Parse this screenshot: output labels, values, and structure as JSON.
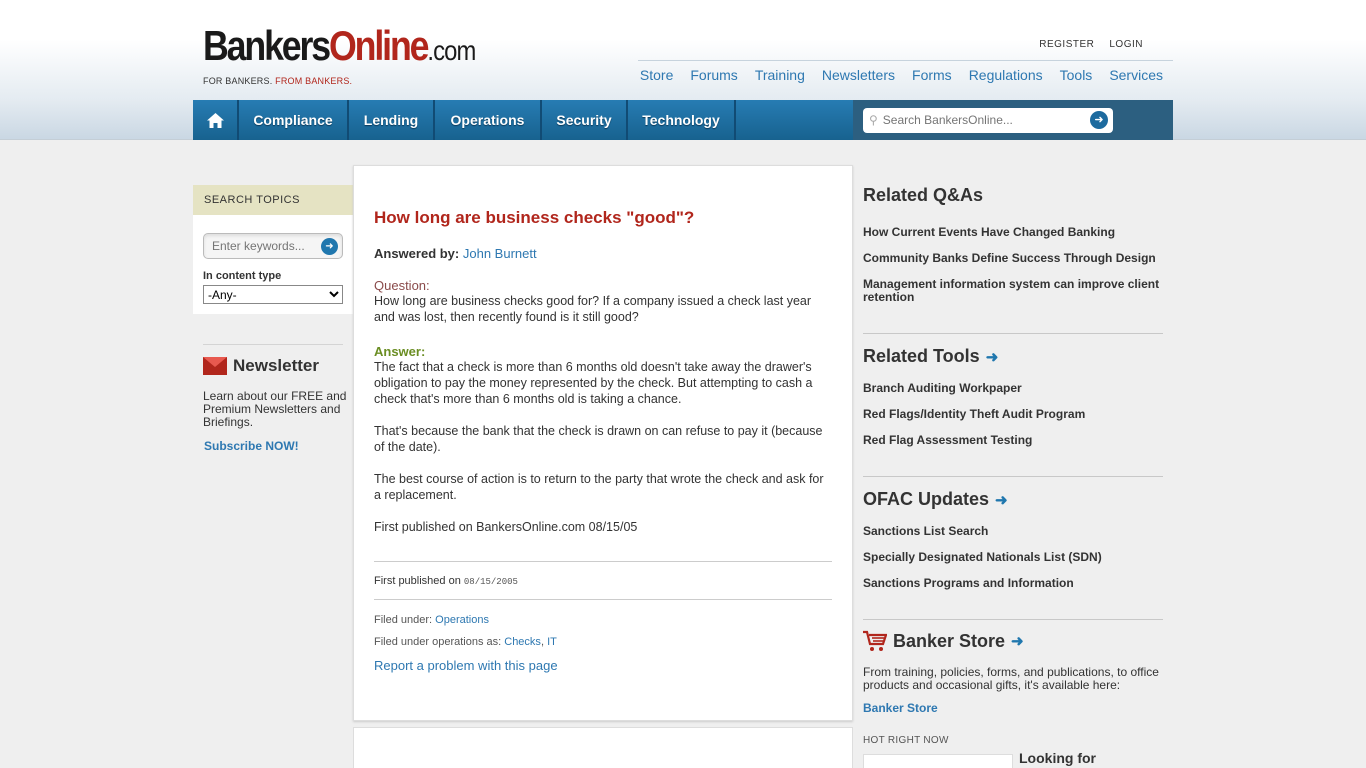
{
  "logo": {
    "part1": "Bankers",
    "part2": "Online",
    "part3": ".com",
    "tagline_a": "FOR BANKERS.",
    "tagline_b": "FROM BANKERS."
  },
  "auth": {
    "register": "REGISTER",
    "login": "LOGIN"
  },
  "util_nav": [
    "Store",
    "Forums",
    "Training",
    "Newsletters",
    "Forms",
    "Regulations",
    "Tools",
    "Services"
  ],
  "main_nav": {
    "compliance": "Compliance",
    "lending": "Lending",
    "operations": "Operations",
    "security": "Security",
    "technology": "Technology"
  },
  "site_search": {
    "placeholder": "Search BankersOnline..."
  },
  "search_topics": {
    "heading": "SEARCH TOPICS",
    "keywords_placeholder": "Enter keywords...",
    "content_type_label": "In content type",
    "content_type_value": "-Any-"
  },
  "newsletter": {
    "title": "Newsletter",
    "text": "Learn about our FREE and Premium Newsletters and Briefings.",
    "link": "Subscribe NOW!"
  },
  "article": {
    "title": "How long are business checks \"good\"?",
    "answered_label": "Answered by:",
    "answered_by": "John Burnett",
    "question_label": "Question:",
    "question": "How long are business checks good for? If a company issued a check last year and was lost, then recently found is it still good?",
    "answer_label": "Answer:",
    "answer_p1": "The fact that a check is more than 6 months old doesn't take away the drawer's obligation to pay the money represented by the check. But attempting to cash a check that's more than 6 months old is taking a chance.",
    "answer_p2": "That's because the bank that the check is drawn on can refuse to pay it (because of the date).",
    "answer_p3": "The best course of action is to return to the party that wrote the check and ask for a replacement.",
    "answer_p4": "First published on BankersOnline.com 08/15/05",
    "pub_label": "First published on",
    "pub_date": "08/15/2005",
    "filed_label": "Filed under:",
    "filed_value": "Operations",
    "filed_ops_label": "Filed under operations as:",
    "filed_ops_a": "Checks",
    "filed_ops_b": "IT",
    "report": "Report a problem with this page"
  },
  "related_qas": {
    "title": "Related Q&As",
    "items": [
      "How Current Events Have Changed Banking",
      "Community Banks Define Success Through Design",
      "Management information system can improve client retention"
    ]
  },
  "related_tools": {
    "title": "Related Tools",
    "items": [
      "Branch Auditing Workpaper",
      "Red Flags/Identity Theft Audit Program",
      "Red Flag Assessment Testing"
    ]
  },
  "ofac": {
    "title": "OFAC Updates",
    "items": [
      "Sanctions List Search",
      "Specially Designated Nationals List (SDN)",
      "Sanctions Programs and Information"
    ]
  },
  "store": {
    "title": "Banker Store",
    "text": "From training, policies, forms, and publications, to office products and occasional gifts, it's available here:",
    "link": "Banker Store",
    "hot_label": "HOT RIGHT NOW",
    "hot_title": "Looking for"
  }
}
